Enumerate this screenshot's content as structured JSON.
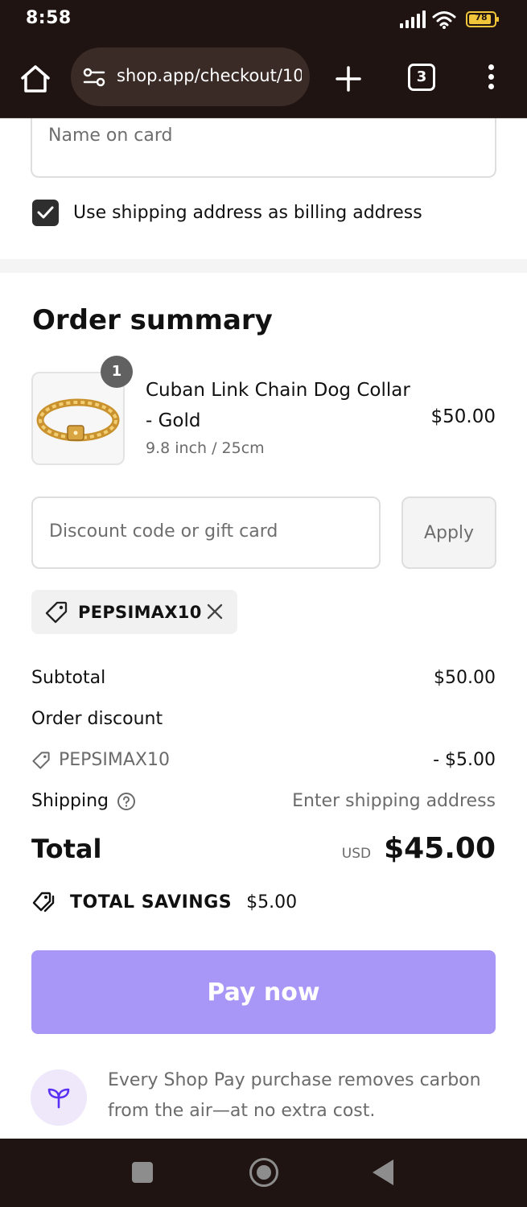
{
  "status_bar": {
    "time": "8:58",
    "battery_level": "78",
    "icons": [
      "signal-icon",
      "wifi-icon",
      "battery-icon"
    ]
  },
  "browser": {
    "url": "shop.app/checkout/10",
    "tab_count": "3",
    "icons": [
      "home-icon",
      "site-settings-icon",
      "new-tab-icon",
      "tabs-icon",
      "more-menu-icon"
    ]
  },
  "payment": {
    "name_on_card_placeholder": "Name on card",
    "billing_same_label": "Use shipping address as billing address",
    "billing_same_checked": true
  },
  "order_summary": {
    "title": "Order summary",
    "item": {
      "quantity": "1",
      "name": "Cuban Link Chain Dog Collar - Gold",
      "variant": "9.8 inch / 25cm",
      "price": "$50.00"
    },
    "discount": {
      "placeholder": "Discount code or gift card",
      "apply_label": "Apply",
      "applied_code": "PEPSIMAX10"
    },
    "totals": {
      "subtotal_label": "Subtotal",
      "subtotal_value": "$50.00",
      "order_discount_label": "Order discount",
      "discount_code": "PEPSIMAX10",
      "discount_value": "- $5.00",
      "shipping_label": "Shipping",
      "shipping_value": "Enter shipping address",
      "total_label": "Total",
      "currency": "USD",
      "total_value": "$45.00",
      "savings_label": "TOTAL SAVINGS",
      "savings_value": "$5.00"
    },
    "pay_button_label": "Pay now",
    "carbon_note": "Every Shop Pay purchase removes carbon from the air—at no extra cost."
  },
  "colors": {
    "chrome_background": "#1f1411",
    "pay_button": "#a897f7",
    "carbon_icon_bg": "#efe8fb",
    "accent_purple": "#5a31f4"
  }
}
